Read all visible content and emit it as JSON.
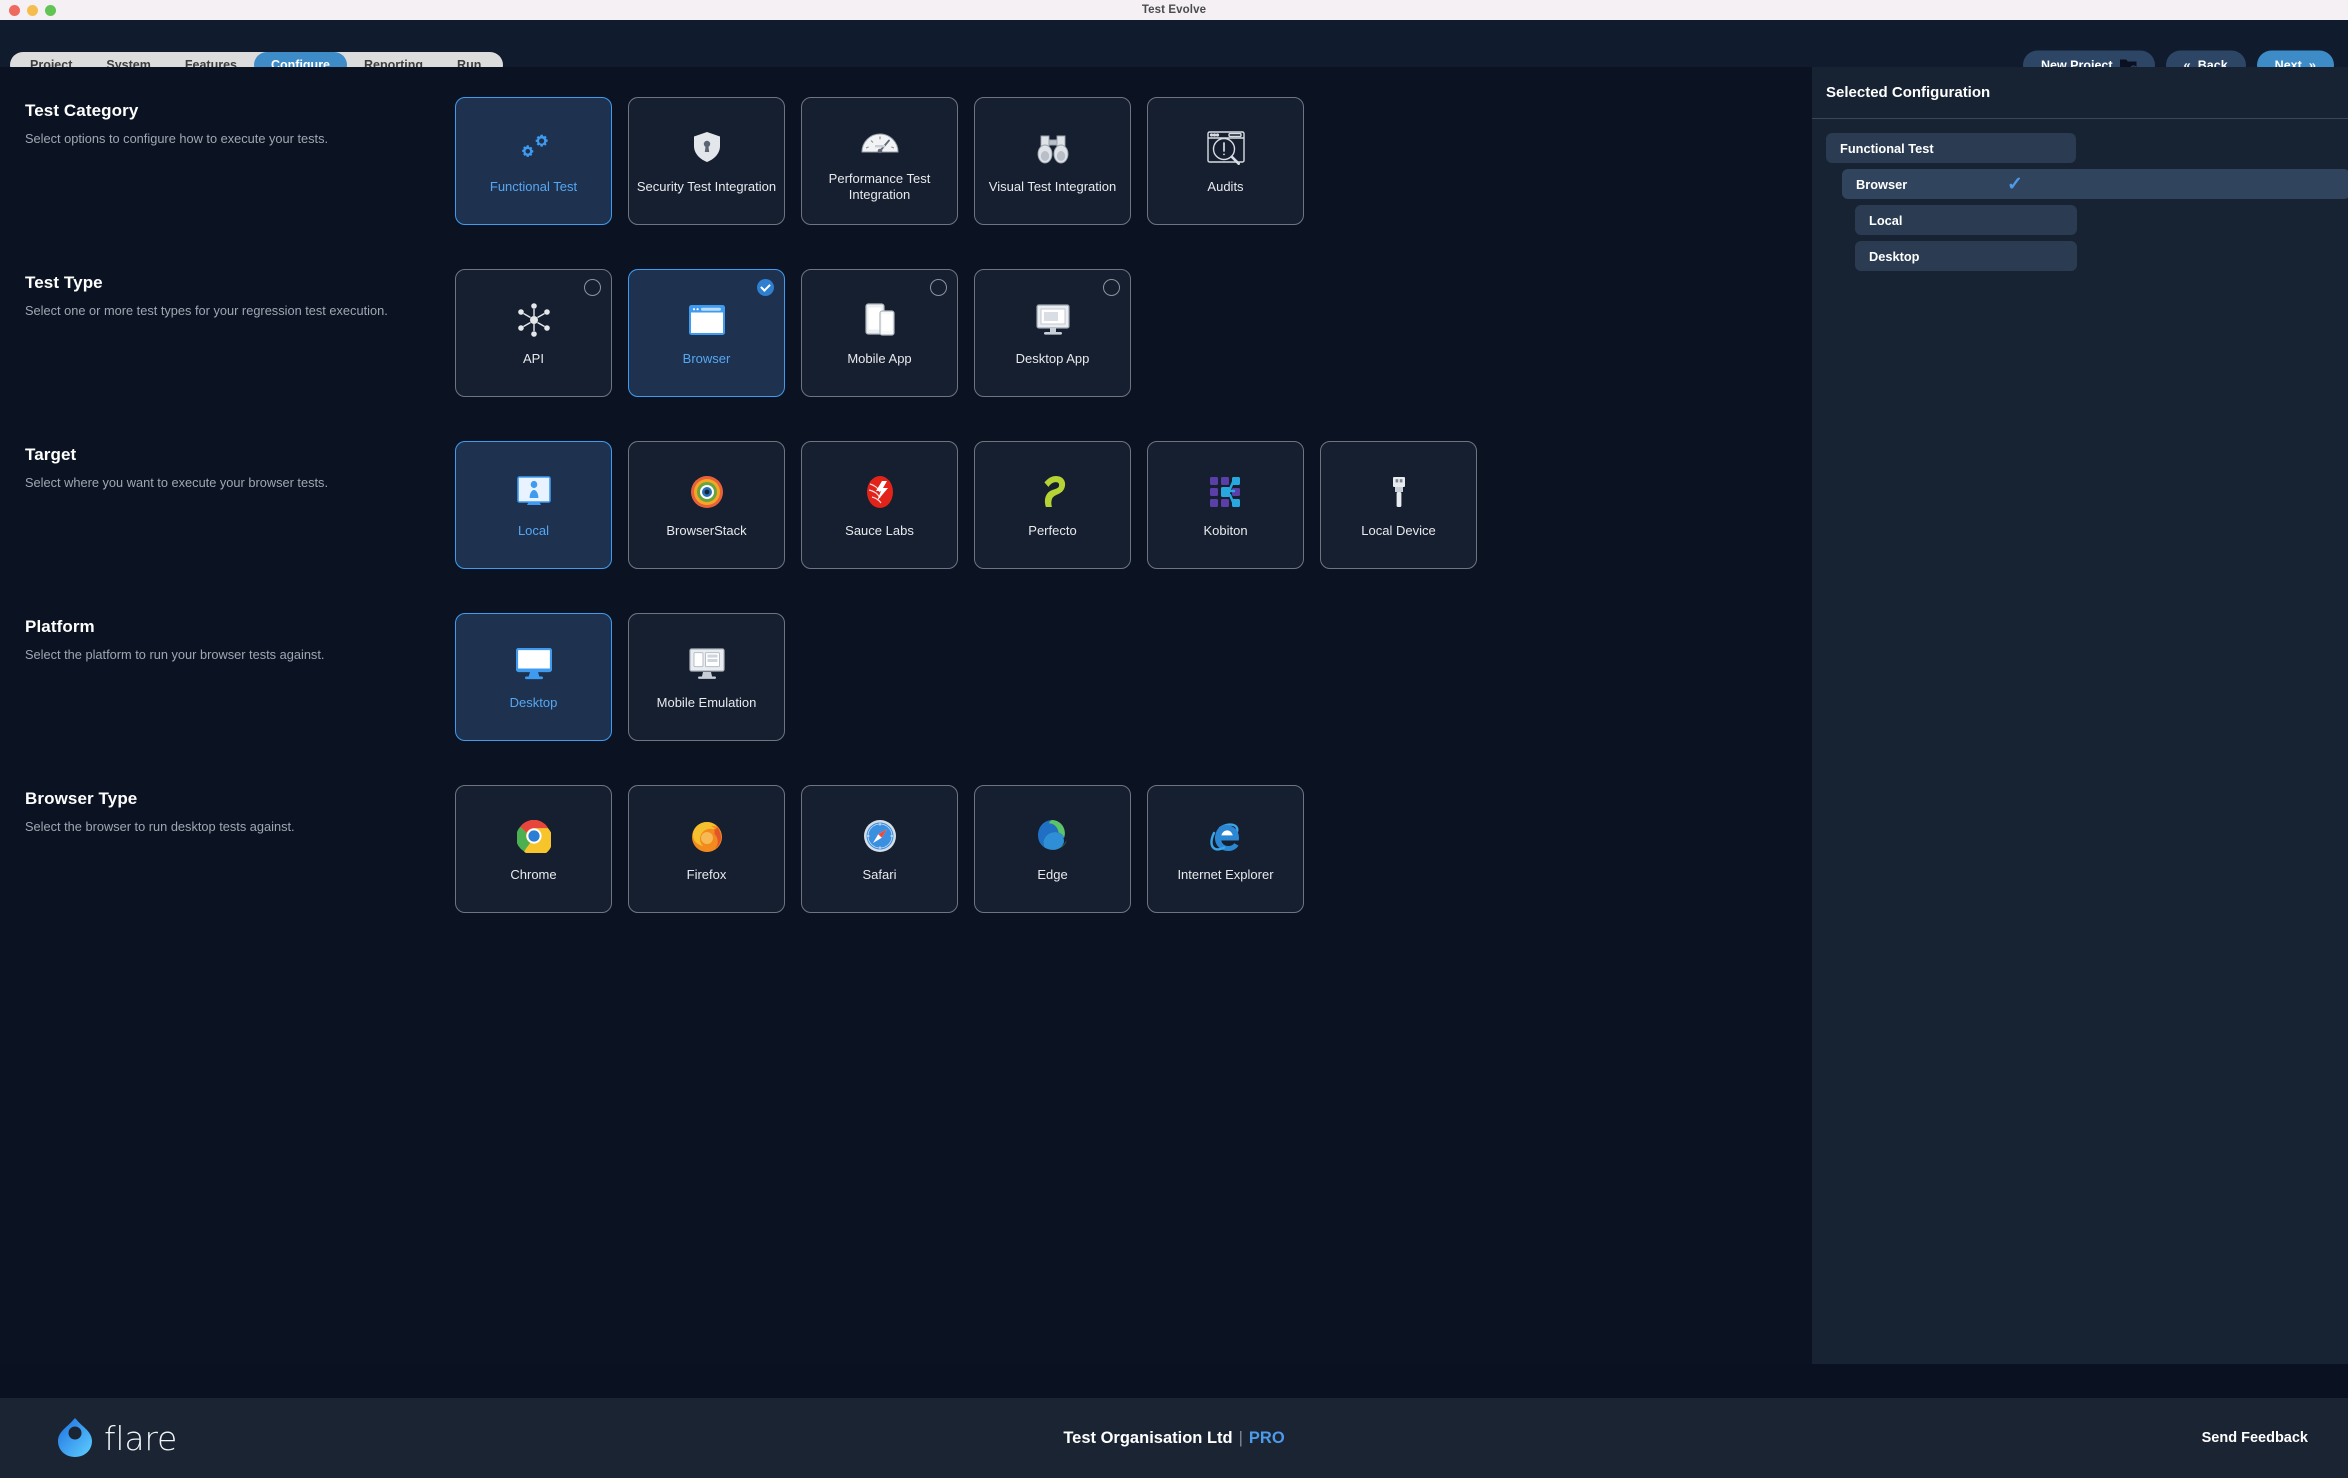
{
  "window": {
    "title": "Test Evolve"
  },
  "nav": {
    "tabs": [
      {
        "label": "Project",
        "active": false
      },
      {
        "label": "System",
        "active": false
      },
      {
        "label": "Features",
        "active": false
      },
      {
        "label": "Configure",
        "active": true
      },
      {
        "label": "Reporting",
        "active": false
      },
      {
        "label": "Run",
        "active": false
      }
    ]
  },
  "toolbar": {
    "new_project_label": "New Project",
    "back_label": "Back",
    "next_label": "Next",
    "back_chevron": "«",
    "next_chevron": "»"
  },
  "sections": [
    {
      "key": "test_category",
      "title": "Test Category",
      "desc": "Select options to configure how to execute your tests.",
      "has_radio": false,
      "tiles": [
        {
          "label": "Functional Test",
          "icon": "gears-icon",
          "selected": true
        },
        {
          "label": "Security Test Integration",
          "icon": "shield-icon",
          "selected": false
        },
        {
          "label": "Performance Test Integration",
          "icon": "gauge-icon",
          "selected": false
        },
        {
          "label": "Visual Test Integration",
          "icon": "binoculars-icon",
          "selected": false
        },
        {
          "label": "Audits",
          "icon": "audit-magnifier-icon",
          "selected": false
        }
      ]
    },
    {
      "key": "test_type",
      "title": "Test Type",
      "desc": "Select one or more test types for your regression test execution.",
      "has_radio": true,
      "tiles": [
        {
          "label": "API",
          "icon": "api-network-icon",
          "selected": false
        },
        {
          "label": "Browser",
          "icon": "browser-window-icon",
          "selected": true
        },
        {
          "label": "Mobile App",
          "icon": "mobile-devices-icon",
          "selected": false
        },
        {
          "label": "Desktop App",
          "icon": "desktop-monitor-icon",
          "selected": false
        }
      ]
    },
    {
      "key": "target",
      "title": "Target",
      "desc": "Select where you want to execute your browser tests.",
      "has_radio": false,
      "tiles": [
        {
          "label": "Local",
          "icon": "local-machine-icon",
          "selected": true
        },
        {
          "label": "BrowserStack",
          "icon": "browserstack-icon",
          "selected": false
        },
        {
          "label": "Sauce Labs",
          "icon": "saucelabs-icon",
          "selected": false
        },
        {
          "label": "Perfecto",
          "icon": "perfecto-icon",
          "selected": false
        },
        {
          "label": "Kobiton",
          "icon": "kobiton-icon",
          "selected": false
        },
        {
          "label": "Local Device",
          "icon": "usb-icon",
          "selected": false
        }
      ]
    },
    {
      "key": "platform",
      "title": "Platform",
      "desc": "Select the platform to run your browser tests against.",
      "has_radio": false,
      "tiles": [
        {
          "label": "Desktop",
          "icon": "monitor-icon",
          "selected": true
        },
        {
          "label": "Mobile Emulation",
          "icon": "mobile-emulation-icon",
          "selected": false
        }
      ]
    },
    {
      "key": "browser_type",
      "title": "Browser Type",
      "desc": "Select the browser to run desktop tests against.",
      "has_radio": false,
      "tiles": [
        {
          "label": "Chrome",
          "icon": "chrome-icon",
          "selected": false
        },
        {
          "label": "Firefox",
          "icon": "firefox-icon",
          "selected": false
        },
        {
          "label": "Safari",
          "icon": "safari-icon",
          "selected": false
        },
        {
          "label": "Edge",
          "icon": "edge-icon",
          "selected": false
        },
        {
          "label": "Internet Explorer",
          "icon": "internet-explorer-icon",
          "selected": false
        }
      ]
    }
  ],
  "panel": {
    "title": "Selected Configuration",
    "rows": [
      {
        "label": "Functional Test",
        "level": 0,
        "check": false
      },
      {
        "label": "Browser",
        "level": 1,
        "check": true
      },
      {
        "label": "Local",
        "level": 2,
        "check": false
      },
      {
        "label": "Desktop",
        "level": 2,
        "check": false
      }
    ],
    "check_glyph": "✓"
  },
  "footer": {
    "logo_text": "flare",
    "organisation": "Test Organisation Ltd",
    "separator": "|",
    "plan": "PRO",
    "feedback_label": "Send Feedback"
  },
  "colors": {
    "accent": "#3d8cc8",
    "selected_tile_bg": "#1e3250",
    "selected_tile_border": "#3e9bf0",
    "panel_bg": "#172232",
    "app_bg": "#0b1322",
    "footer_bg": "#1a2433",
    "pro_blue": "#4c9ae8"
  }
}
